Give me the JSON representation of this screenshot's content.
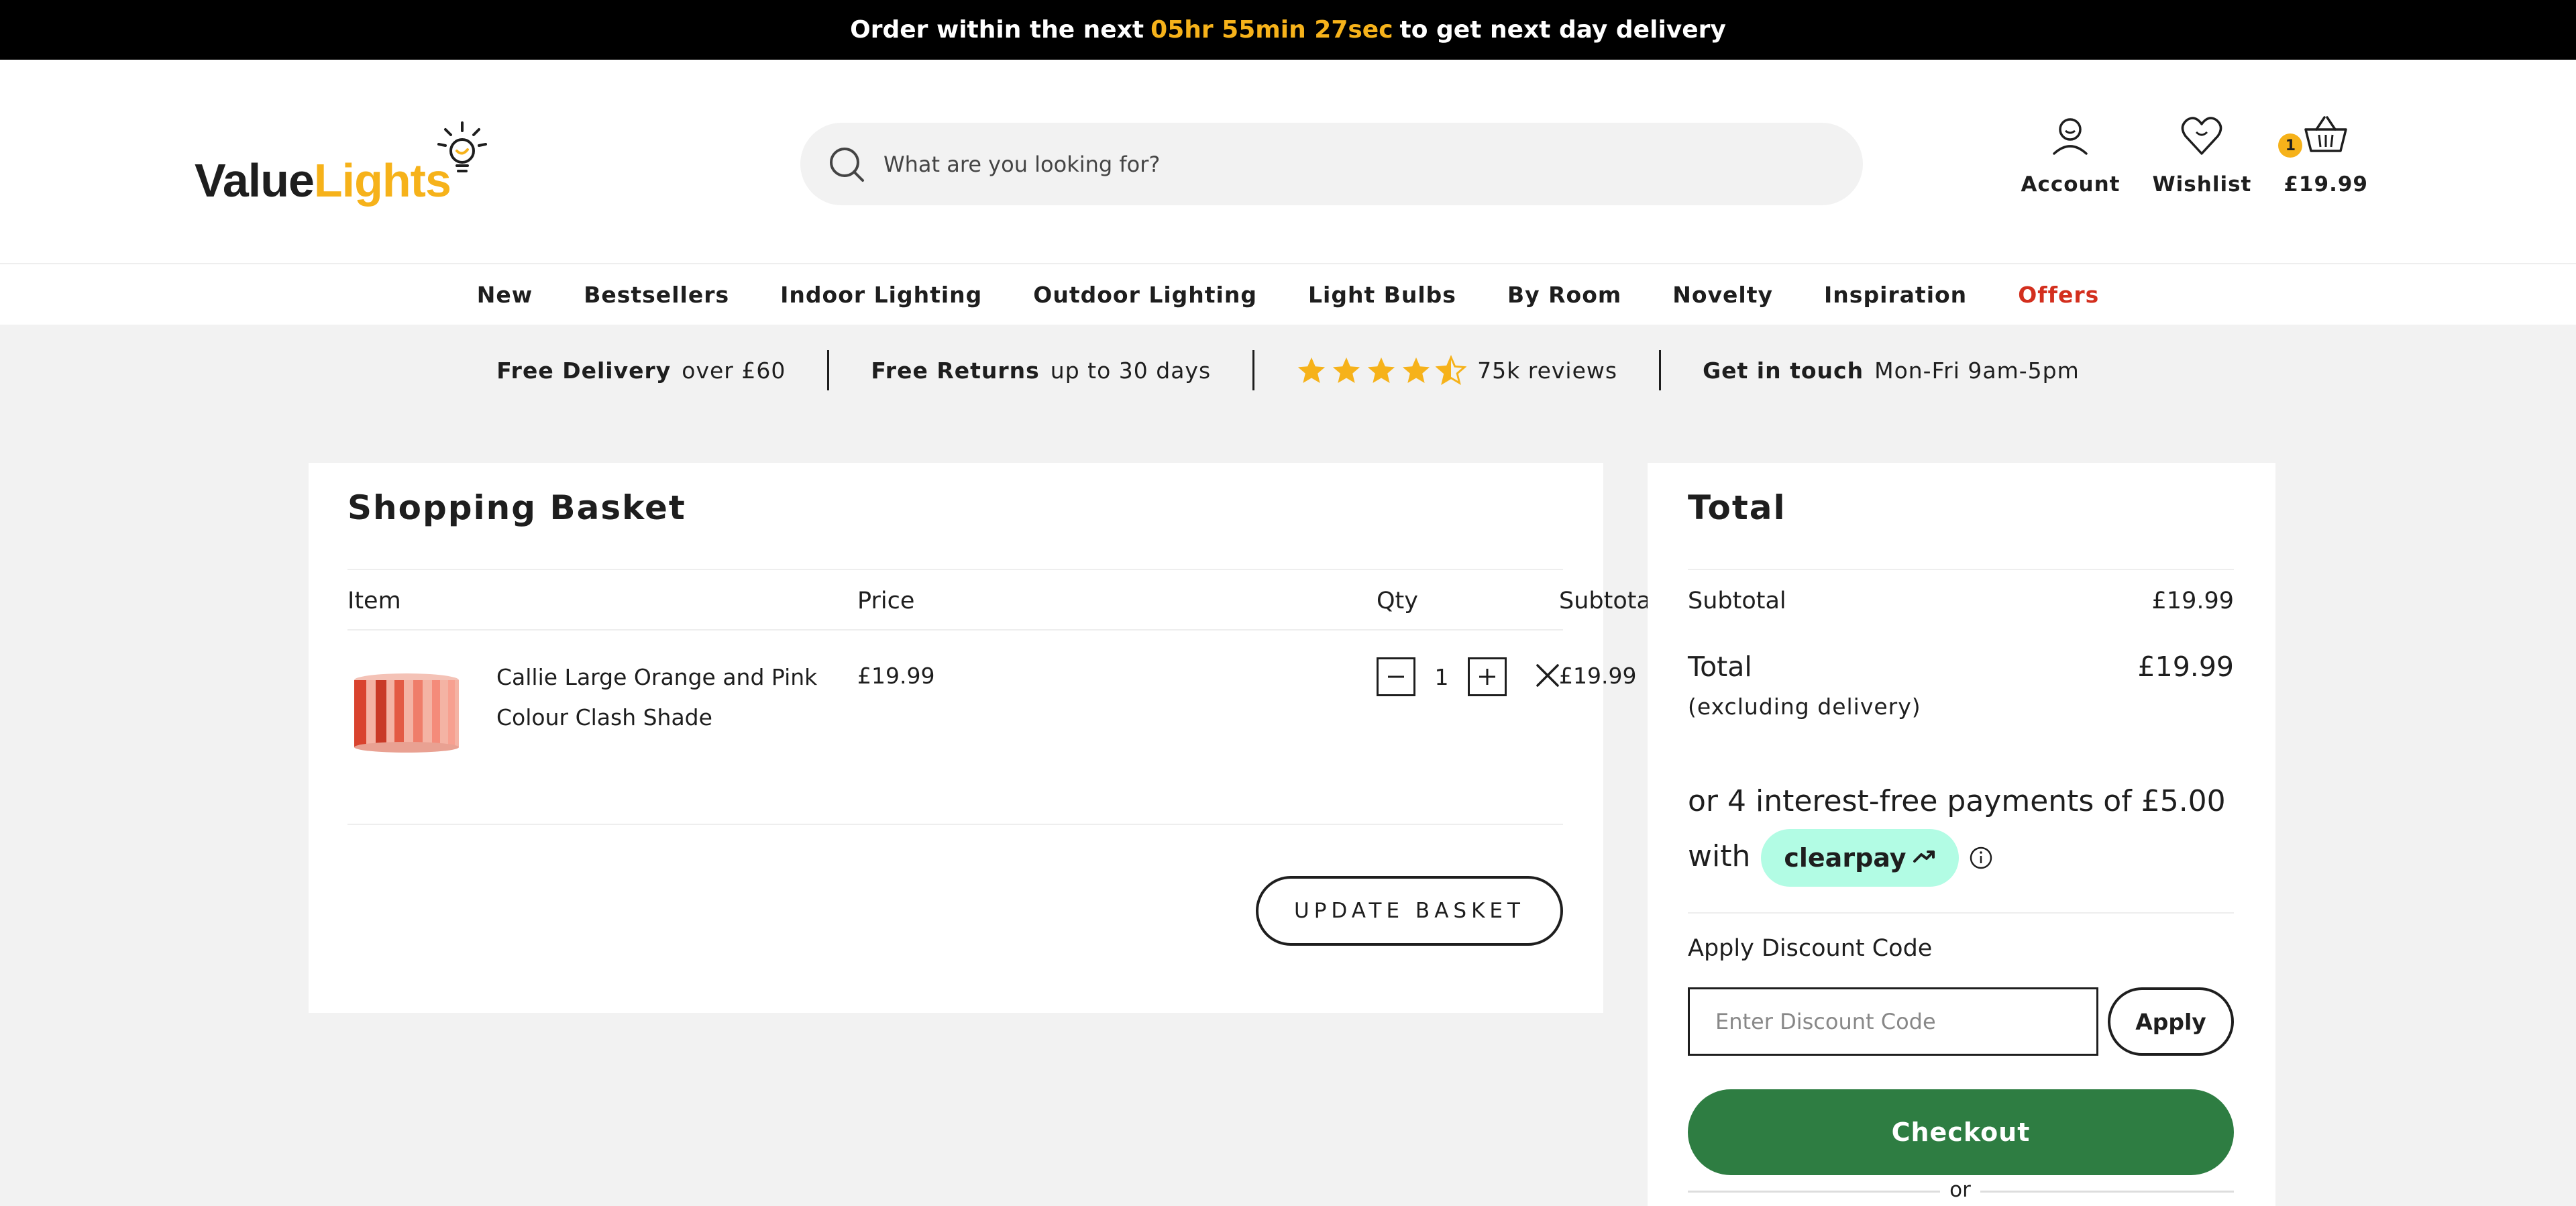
{
  "promo": {
    "prefix": "Order within the next",
    "timer": "05hr 55min 27sec",
    "suffix": "to get next day delivery"
  },
  "header": {
    "logo": {
      "value": "Value",
      "lights": "Lights"
    },
    "search_placeholder": "What are you looking for?",
    "account_label": "Account",
    "wishlist_label": "Wishlist",
    "basket_total": "£19.99",
    "basket_count": "1"
  },
  "nav": {
    "items": [
      "New",
      "Bestsellers",
      "Indoor Lighting",
      "Outdoor Lighting",
      "Light Bulbs",
      "By Room",
      "Novelty",
      "Inspiration",
      "Offers"
    ],
    "offers_color": "#d32f1e"
  },
  "usps": {
    "delivery_bold": "Free Delivery",
    "delivery_rest": "over £60",
    "returns_bold": "Free Returns",
    "returns_rest": "up to 30 days",
    "rating_stars": 4.5,
    "reviews": "75k reviews",
    "contact_bold": "Get in touch",
    "contact_rest": "Mon-Fri 9am-5pm"
  },
  "basket": {
    "title": "Shopping Basket",
    "columns": [
      "Item",
      "Price",
      "Qty",
      "Subtotal"
    ],
    "items": [
      {
        "name": "Callie Large Orange and Pink Colour Clash Shade",
        "price": "£19.99",
        "qty": "1",
        "subtotal": "£19.99"
      }
    ],
    "update_label": "UPDATE BASKET"
  },
  "totals": {
    "title": "Total",
    "subtotal_label": "Subtotal",
    "subtotal_value": "£19.99",
    "total_label": "Total",
    "total_value": "£19.99",
    "total_note": "(excluding delivery)",
    "clearpay_text": "or 4 interest-free payments of £5.00",
    "clearpay_with": "with",
    "clearpay_brand": "clearpay",
    "discount_label": "Apply Discount Code",
    "discount_placeholder": "Enter Discount Code",
    "apply_label": "Apply",
    "checkout_label": "Checkout",
    "or_label": "or"
  },
  "colors": {
    "accent": "#f6b21a",
    "checkout": "#2e7d42",
    "clearpay": "#b2fce4"
  }
}
